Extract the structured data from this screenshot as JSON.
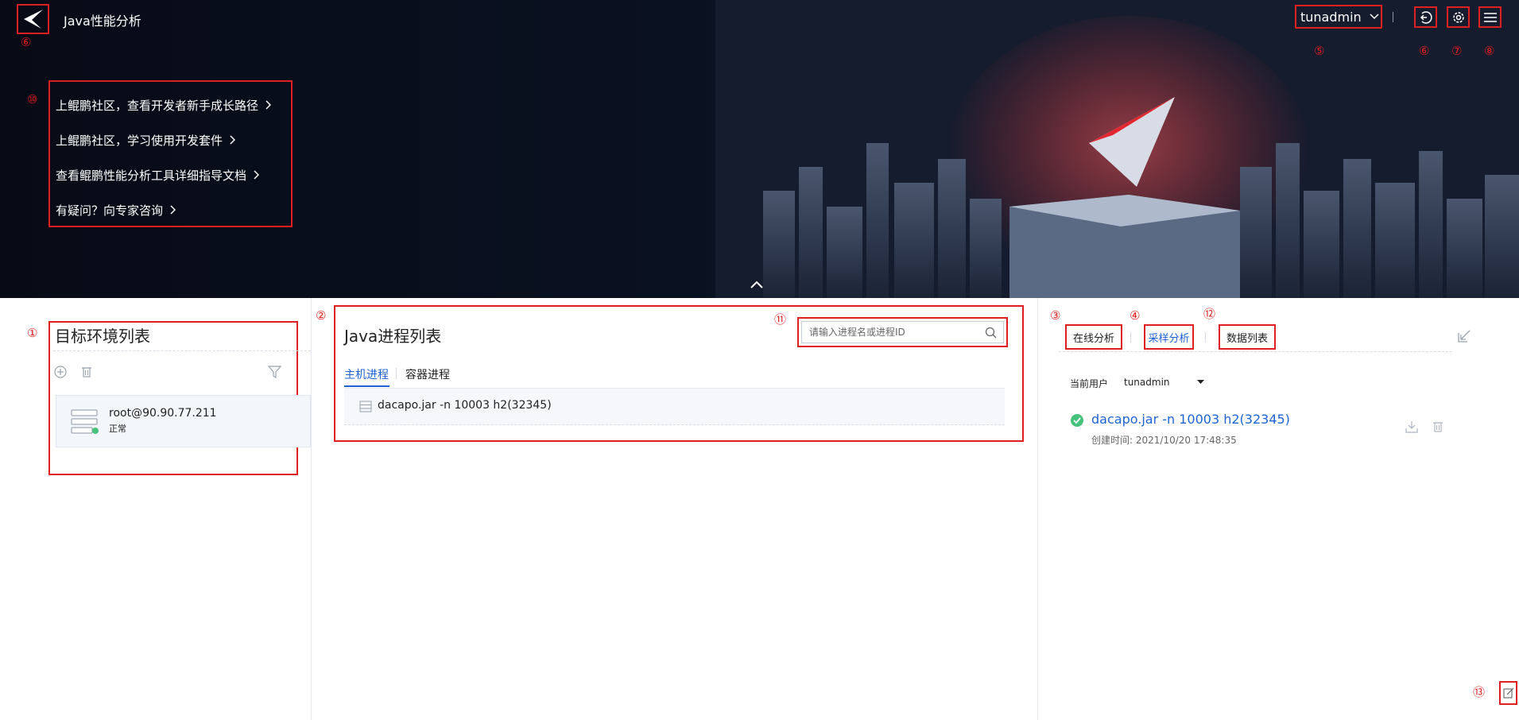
{
  "header": {
    "app_title": "Java性能分析",
    "username": "tunadmin",
    "logo_marker": "⑥",
    "user_marker": "⑤",
    "logout_marker": "⑥",
    "settings_marker": "⑦",
    "menu_marker": "⑧",
    "icons": [
      "logo-icon",
      "chevron-down-icon",
      "logout-icon",
      "gear-icon",
      "menu-icon",
      "chevron-up-icon"
    ]
  },
  "hero": {
    "links_marker": "⑩",
    "links": [
      "上鲲鹏社区，查看开发者新手成长路径",
      "上鲲鹏社区，学习使用开发套件",
      "查看鲲鹏性能分析工具详细指导文档",
      "有疑问？向专家咨询"
    ]
  },
  "targets": {
    "marker": "①",
    "title": "目标环境列表",
    "host_name": "root@90.90.77.211",
    "host_status": "正常",
    "icons": [
      "add-icon",
      "delete-icon",
      "filter-icon",
      "server-icon"
    ]
  },
  "processes": {
    "marker": "②",
    "search_marker": "⑪",
    "title": "Java进程列表",
    "search_placeholder": "请输入进程名或进程ID",
    "tabs": [
      "主机进程",
      "容器进程"
    ],
    "rows": [
      "dacapo.jar -n 10003 h2(32345)"
    ]
  },
  "analysis": {
    "marker_online": "③",
    "marker_sampling": "④",
    "marker_data": "⑫",
    "marker_feedback": "⑬",
    "tabs": [
      "在线分析",
      "采样分析",
      "数据列表"
    ],
    "current_user_label": "当前用户",
    "current_user_value": "tunadmin",
    "record_name": "dacapo.jar -n 10003 h2(32345)",
    "record_time": "创建时间: 2021/10/20 17:48:35"
  },
  "colors": {
    "accent": "#1e63d6",
    "annotation": "#e02020",
    "success": "#46c37b"
  }
}
